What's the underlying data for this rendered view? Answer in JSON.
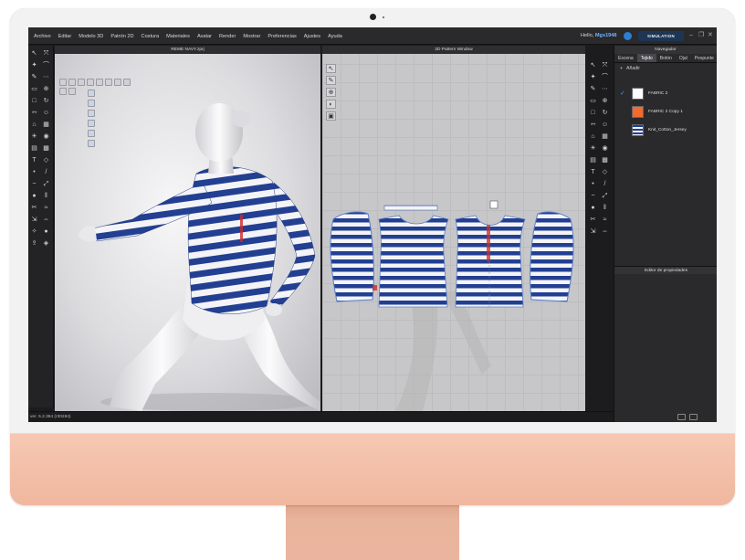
{
  "menu": [
    "Archivo",
    "Editar",
    "Modelo 3D",
    "Patrón 2D",
    "Costura",
    "Materiales",
    "Avatar",
    "Render",
    "Mostrar",
    "Preferencias",
    "Ajustes",
    "Ayuda"
  ],
  "user": {
    "greeting": "Hello,",
    "name": "Mgs1948"
  },
  "simulation_label": "SIMULATION",
  "window_controls": [
    "–",
    "❐",
    "✕"
  ],
  "pane_3d_title": "REME NAVY.zprj",
  "pane_2d_title": "2D Pattern Window",
  "right_panel": {
    "title": "Navegador",
    "tabs": [
      "Escena",
      "Tejido",
      "Botón",
      "Ojal",
      "Pespunte"
    ],
    "active_tab": "Tejido",
    "add_label": "Añadir",
    "fabrics": [
      {
        "name": "FABRIC 2",
        "color": "#ffffff",
        "checked": true
      },
      {
        "name": "FABRIC 2 Copy 1",
        "color": "#f26a2e",
        "checked": false
      },
      {
        "name": "Knit_Cotton_Jersey",
        "color": "#2a4f9c",
        "checked": false
      }
    ],
    "properties_title": "Editor de propiedades"
  },
  "status": {
    "version": "ver. 5.2.364 (r30284)"
  },
  "colors": {
    "stripe_navy": "#223f92",
    "stripe_white": "#f4f4f6",
    "accent_blue": "#3aa0ff",
    "monitor_peach": "#f4c3ad"
  },
  "icons": {
    "left_tools": [
      "cursor-icon",
      "transform-icon",
      "pin-icon",
      "fold-icon",
      "brush-icon",
      "seam-icon",
      "tape-icon",
      "zoom-icon",
      "box-icon",
      "rotate-icon",
      "measure-icon",
      "avatar-icon",
      "hanger-icon",
      "grid-icon",
      "light-icon",
      "camera-icon",
      "layer-icon",
      "texture-icon",
      "shirt-icon",
      "pattern-icon",
      "point-icon",
      "line-icon",
      "curve-icon",
      "scale-icon",
      "button-icon",
      "zipper-icon",
      "trim-icon",
      "puckering-icon",
      "shrink-icon",
      "fit-icon",
      "pose-icon",
      "record-icon",
      "export-icon",
      "render-icon"
    ],
    "right_tools": [
      "select-icon",
      "edit-point-icon",
      "polygon-icon",
      "rectangle-icon",
      "circle-icon",
      "dart-icon",
      "internal-line-icon",
      "notch-icon",
      "seam-line-icon",
      "segment-sew-icon",
      "free-sew-icon",
      "trace-icon",
      "symmetry-icon",
      "gradient-icon",
      "texture-edit-icon",
      "graphic-icon",
      "topstitch-icon",
      "puckering-icon",
      "button-icon",
      "buttonhole-icon",
      "zipper-icon",
      "piping-icon",
      "elastic-icon",
      "fold-icon",
      "text-icon",
      "ruler-icon",
      "grade-icon",
      "annotation-icon",
      "sewing-check-icon",
      "layout-icon"
    ]
  }
}
